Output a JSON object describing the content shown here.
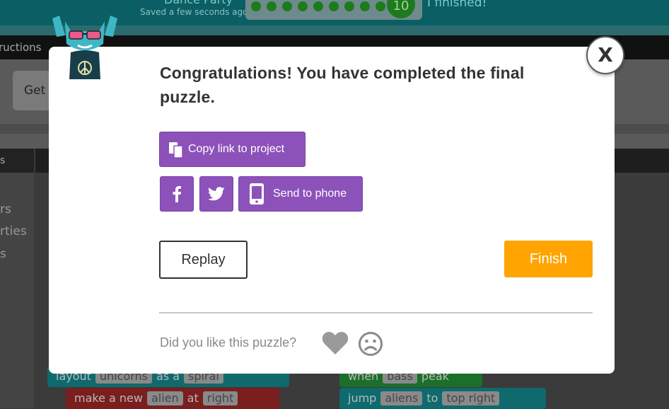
{
  "background": {
    "header": {
      "title_partial": "Dance Party",
      "saved_status": "Saved a few seconds ago",
      "level_number": "10",
      "finished_label": "I finished!"
    },
    "instructions_tab": "ructions",
    "get_started": "Get",
    "category_header": "s",
    "categories": [
      "rs",
      "rties",
      "s"
    ],
    "blocks_left": [
      {
        "text": "layout",
        "slot1": "unicorns",
        "mid": "as a",
        "slot2": "spiral"
      },
      {
        "text": "make a new",
        "slot1": "alien",
        "mid": "at",
        "slot2": "right"
      }
    ],
    "blocks_right": [
      {
        "text": "when",
        "slot1": "bass",
        "mid": "peak"
      },
      {
        "text": "jump",
        "slot1": "aliens",
        "mid": "to",
        "slot2": "top right"
      }
    ]
  },
  "dialog": {
    "title": "Congratulations! You have completed the final puzzle.",
    "copy_link_label": "Copy link to project",
    "send_to_phone_label": "Send to phone",
    "replay_label": "Replay",
    "finish_label": "Finish",
    "feedback_prompt": "Did you like this puzzle?",
    "close_label": "X"
  },
  "colors": {
    "share_purple": "#8c52ba",
    "finish_orange": "#ffa400",
    "mascot_teal": "#3fb6c6"
  },
  "icons": [
    "cat-mascot-icon",
    "copy-icon",
    "facebook-icon",
    "twitter-icon",
    "phone-icon",
    "heart-icon",
    "frown-icon",
    "close-icon"
  ]
}
